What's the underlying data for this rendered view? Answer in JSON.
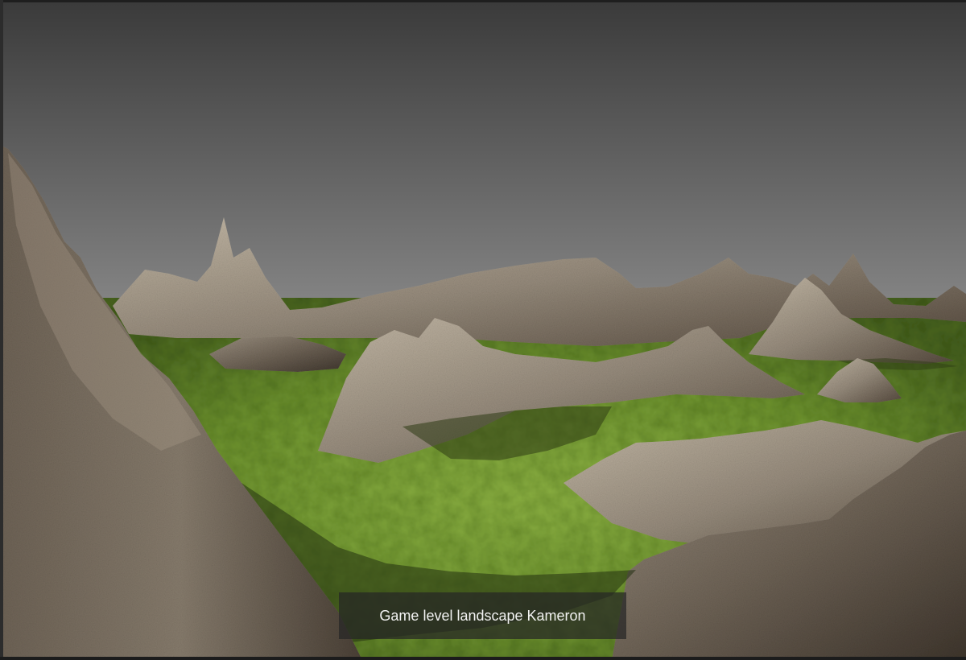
{
  "caption": {
    "text": "Game level landscape Kameron"
  },
  "scene": {
    "description_colors": {
      "sky_top": "#3a3a3a",
      "sky_bottom": "#8a8a8a",
      "grass_light": "#8cae3e",
      "grass_dark": "#4e6a1e",
      "rock_light": "#b8ad9c",
      "rock_mid": "#8a7f70",
      "rock_dark": "#4a4238"
    }
  }
}
